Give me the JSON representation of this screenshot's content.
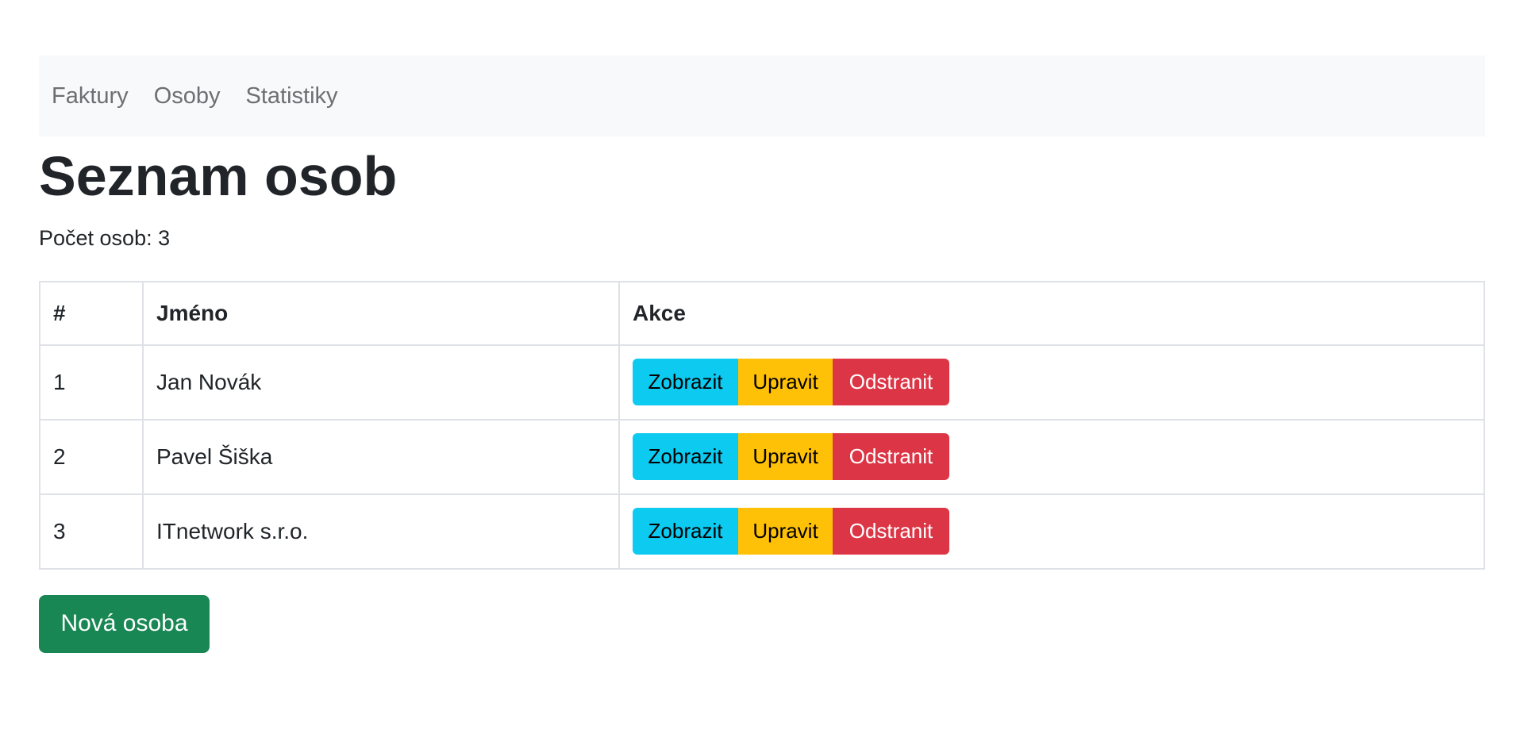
{
  "nav": {
    "items": [
      "Faktury",
      "Osoby",
      "Statistiky"
    ]
  },
  "page": {
    "title": "Seznam osob",
    "count_label": "Počet osob: 3"
  },
  "table": {
    "headers": [
      "#",
      "Jméno",
      "Akce"
    ],
    "rows": [
      {
        "num": "1",
        "name": "Jan Novák"
      },
      {
        "num": "2",
        "name": "Pavel Šiška"
      },
      {
        "num": "3",
        "name": "ITnetwork s.r.o."
      }
    ],
    "actions": {
      "view": "Zobrazit",
      "edit": "Upravit",
      "delete": "Odstranit"
    }
  },
  "new_button": "Nová osoba",
  "colors": {
    "navbar_bg": "#f8f9fa",
    "info": "#0dcaf0",
    "warning": "#ffc107",
    "danger": "#dc3545",
    "success": "#198754"
  }
}
